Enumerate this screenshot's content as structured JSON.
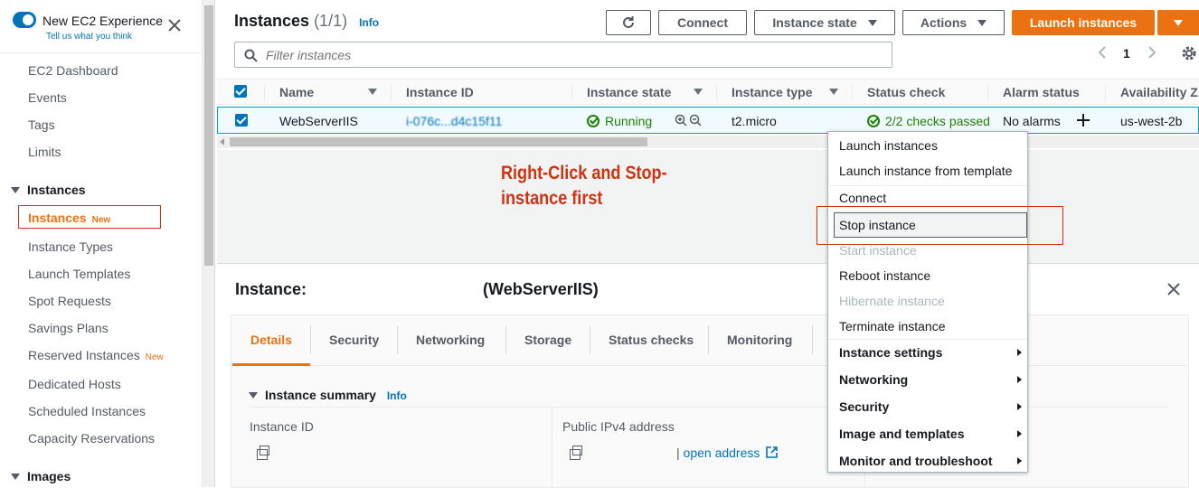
{
  "sidebar": {
    "experience_title": "New EC2 Experience",
    "experience_sub": "Tell us what you think",
    "close": "✕",
    "items": [
      "EC2 Dashboard",
      "Events",
      "Tags",
      "Limits"
    ],
    "instances_header": "Instances",
    "instances_items": [
      {
        "label": "Instances",
        "badge": "New"
      },
      {
        "label": "Instance Types"
      },
      {
        "label": "Launch Templates"
      },
      {
        "label": "Spot Requests"
      },
      {
        "label": "Savings Plans"
      },
      {
        "label": "Reserved Instances",
        "badge": "New"
      },
      {
        "label": "Dedicated Hosts"
      },
      {
        "label": "Scheduled Instances"
      },
      {
        "label": "Capacity Reservations"
      }
    ],
    "images_header": "Images"
  },
  "header": {
    "title": "Instances",
    "count": "(1/1)",
    "info": "Info",
    "connect": "Connect",
    "instance_state": "Instance state",
    "actions": "Actions",
    "launch": "Launch instances"
  },
  "filter": {
    "placeholder": "Filter instances"
  },
  "pagination": {
    "page": "1"
  },
  "table": {
    "columns": [
      "Name",
      "Instance ID",
      "Instance state",
      "Instance type",
      "Status check",
      "Alarm status",
      "Availability Z"
    ],
    "row": {
      "name": "WebServerIIS",
      "instance_id": "i-076c...d4c15f11",
      "state": "Running",
      "type": "t2.micro",
      "status": "2/2 checks passed",
      "alarm": "No alarms",
      "az": "us-west-2b"
    }
  },
  "annotation": "Right-Click and Stop-instance first",
  "details": {
    "title_prefix": "Instance:",
    "title_name": "(WebServerIIS)",
    "tabs": [
      "Details",
      "Security",
      "Networking",
      "Storage",
      "Status checks",
      "Monitoring"
    ],
    "summary": "Instance summary",
    "summary_info": "Info",
    "instance_id_label": "Instance ID",
    "ipv4_label": "Public IPv4 address",
    "open_address": "open address"
  },
  "context_menu": {
    "items": [
      {
        "label": "Launch instances",
        "disabled": false
      },
      {
        "label": "Launch instance from template",
        "disabled": false
      },
      {
        "label": "Connect",
        "disabled": false
      },
      {
        "label": "Stop instance",
        "disabled": false,
        "highlighted": true
      },
      {
        "label": "Start instance",
        "disabled": true
      },
      {
        "label": "Reboot instance",
        "disabled": false
      },
      {
        "label": "Hibernate instance",
        "disabled": true
      },
      {
        "label": "Terminate instance",
        "disabled": false
      },
      {
        "label": "Instance settings",
        "submenu": true
      },
      {
        "label": "Networking",
        "submenu": true
      },
      {
        "label": "Security",
        "submenu": true
      },
      {
        "label": "Image and templates",
        "submenu": true
      },
      {
        "label": "Monitor and troubleshoot",
        "submenu": true
      }
    ]
  },
  "colors": {
    "accent": "#0073bb",
    "launch": "#ec7211",
    "running": "#1d8102",
    "annotation": "#d13212"
  }
}
